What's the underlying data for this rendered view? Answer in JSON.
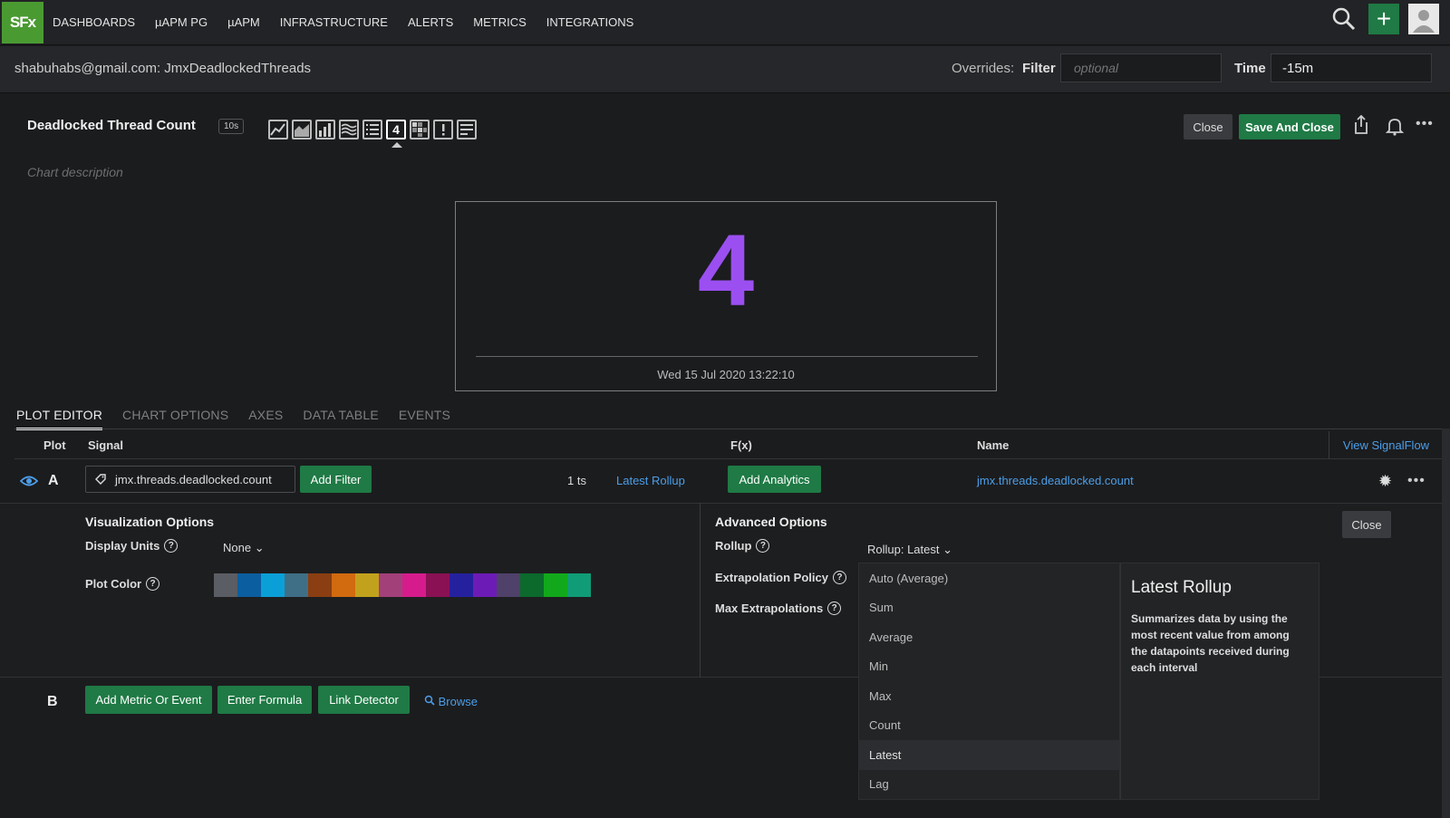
{
  "nav": {
    "logo": "SFx",
    "items": [
      "DASHBOARDS",
      "µAPM PG",
      "µAPM",
      "INFRASTRUCTURE",
      "ALERTS",
      "METRICS",
      "INTEGRATIONS"
    ]
  },
  "header": {
    "breadcrumb": "shabuhabs@gmail.com: JmxDeadlockedThreads",
    "overrides_label": "Overrides:",
    "filter_label": "Filter",
    "filter_placeholder": "optional",
    "time_label": "Time",
    "time_value": "-15m"
  },
  "chart": {
    "title": "Deadlocked Thread Count",
    "resolution": "10s",
    "description_placeholder": "Chart description",
    "close_label": "Close",
    "save_close_label": "Save And Close",
    "viz_types": [
      "line-chart-icon",
      "area-chart-icon",
      "column-chart-icon",
      "histogram-icon",
      "list-icon",
      "single-value-icon",
      "heatmap-icon",
      "event-feed-icon",
      "text-icon"
    ],
    "single_value_label": "4"
  },
  "single_value": {
    "value": "4",
    "timestamp": "Wed 15 Jul 2020 13:22:10",
    "color": "#9b4ff0"
  },
  "tabs": [
    "PLOT EDITOR",
    "CHART OPTIONS",
    "AXES",
    "DATA TABLE",
    "EVENTS"
  ],
  "table": {
    "headers": {
      "plot": "Plot",
      "signal": "Signal",
      "fx": "F(x)",
      "name": "Name"
    },
    "view_signalflow": "View SignalFlow"
  },
  "plotA": {
    "letter": "A",
    "signal": "jmx.threads.deadlocked.count",
    "add_filter": "Add Filter",
    "ts_count": "1 ts",
    "rollup_link": "Latest Rollup",
    "add_analytics": "Add Analytics",
    "name": "jmx.threads.deadlocked.count"
  },
  "viz_options": {
    "title": "Visualization Options",
    "display_units_label": "Display Units",
    "display_units_value": "None",
    "plot_color_label": "Plot Color",
    "colors": [
      "#5a5d63",
      "#0b5e9f",
      "#0b9fd8",
      "#3f6f86",
      "#8a3e12",
      "#d26a10",
      "#c2a21c",
      "#a2407a",
      "#d61c8c",
      "#8a1154",
      "#25219e",
      "#6d1bb7",
      "#4f4169",
      "#0b6a2c",
      "#11a91b",
      "#109c76"
    ]
  },
  "advanced_options": {
    "title": "Advanced Options",
    "rollup_label": "Rollup",
    "rollup_value": "Rollup: Latest",
    "extrapolation_label": "Extrapolation Policy",
    "max_extrapolations_label": "Max Extrapolations",
    "close_label": "Close"
  },
  "rollup_dropdown": {
    "options": [
      "Auto (Average)",
      "Sum",
      "Average",
      "Min",
      "Max",
      "Count",
      "Latest",
      "Lag"
    ],
    "selected": "Latest",
    "info_title": "Latest Rollup",
    "info_text": "Summarizes data by using the most recent value from among the datapoints received during each interval"
  },
  "plotB": {
    "letter": "B",
    "add_metric": "Add Metric Or Event",
    "enter_formula": "Enter Formula",
    "link_detector": "Link Detector",
    "browse": "Browse"
  }
}
